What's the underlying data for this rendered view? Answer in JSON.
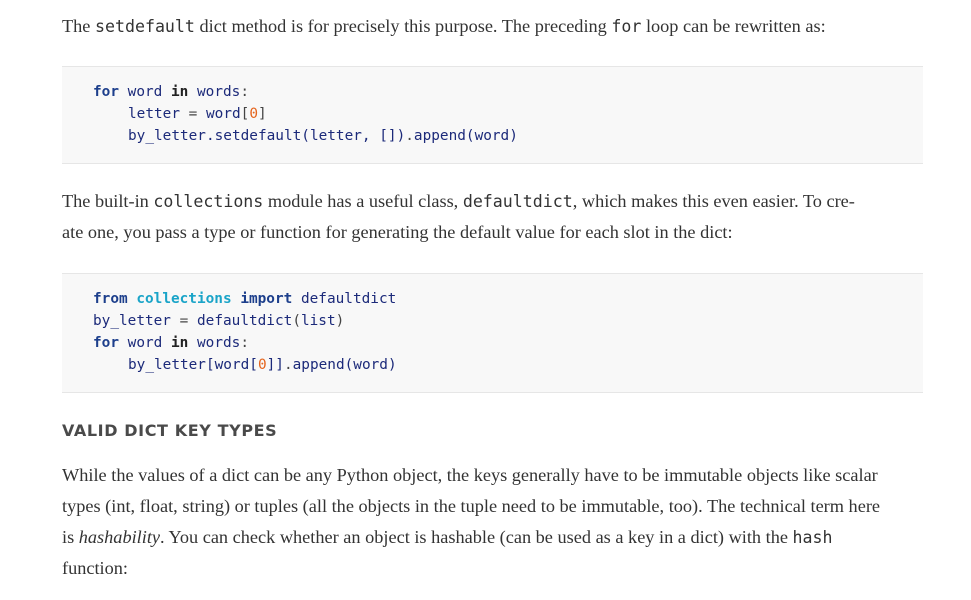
{
  "para1": {
    "t1": "The ",
    "c1": "setdefault",
    "t2": " dict method is for precisely this purpose. The preceding ",
    "c2": "for",
    "t3": " loop can be rewritten as:"
  },
  "code1": {
    "l1": {
      "kw_for": "for",
      "var": "word",
      "kw_in": "in",
      "iter": "words",
      "colon": ":"
    },
    "l2": {
      "lhs": "letter",
      "eq": "=",
      "obj": "word",
      "lb": "[",
      "idx": "0",
      "rb": "]"
    },
    "l3": {
      "call": "by_letter.setdefault(letter, [])",
      "dot": ".",
      "meth": "append",
      "args": "(word)"
    }
  },
  "para2": {
    "t1": "The built-in ",
    "c1": "collections",
    "t2": " module has a useful class, ",
    "c2": "defaultdict",
    "t3": ", which makes this even easier. To cre-",
    "t4": "ate one, you pass a type or function for generating the default value for each slot in the dict:"
  },
  "code2": {
    "l1": {
      "kw_from": "from",
      "mod": "collections",
      "kw_import": "import",
      "name": "defaultdict"
    },
    "l2": {
      "lhs": "by_letter",
      "eq": "=",
      "call": "defaultdict",
      "lp": "(",
      "arg": "list",
      "rp": ")"
    },
    "l3": {
      "kw_for": "for",
      "var": "word",
      "kw_in": "in",
      "iter": "words",
      "colon": ":"
    },
    "l4": {
      "pre": "by_letter[word[",
      "idx": "0",
      "post": "]]",
      "dot": ".",
      "meth": "append",
      "args": "(word)"
    }
  },
  "heading": "VALID DICT KEY TYPES",
  "para3": {
    "l1": "While the values of a dict can be any Python object, the keys generally have to be immutable objects like scalar",
    "l2": "types (int, float, string) or tuples (all the objects in the tuple need to be immutable, too). The technical term here",
    "l3_a": "is ",
    "l3_em": "hashability",
    "l3_b": ". You can check whether an object is hashable (can be used as a key in a dict) with the ",
    "l3_code": "hash",
    "l4": "function:"
  }
}
